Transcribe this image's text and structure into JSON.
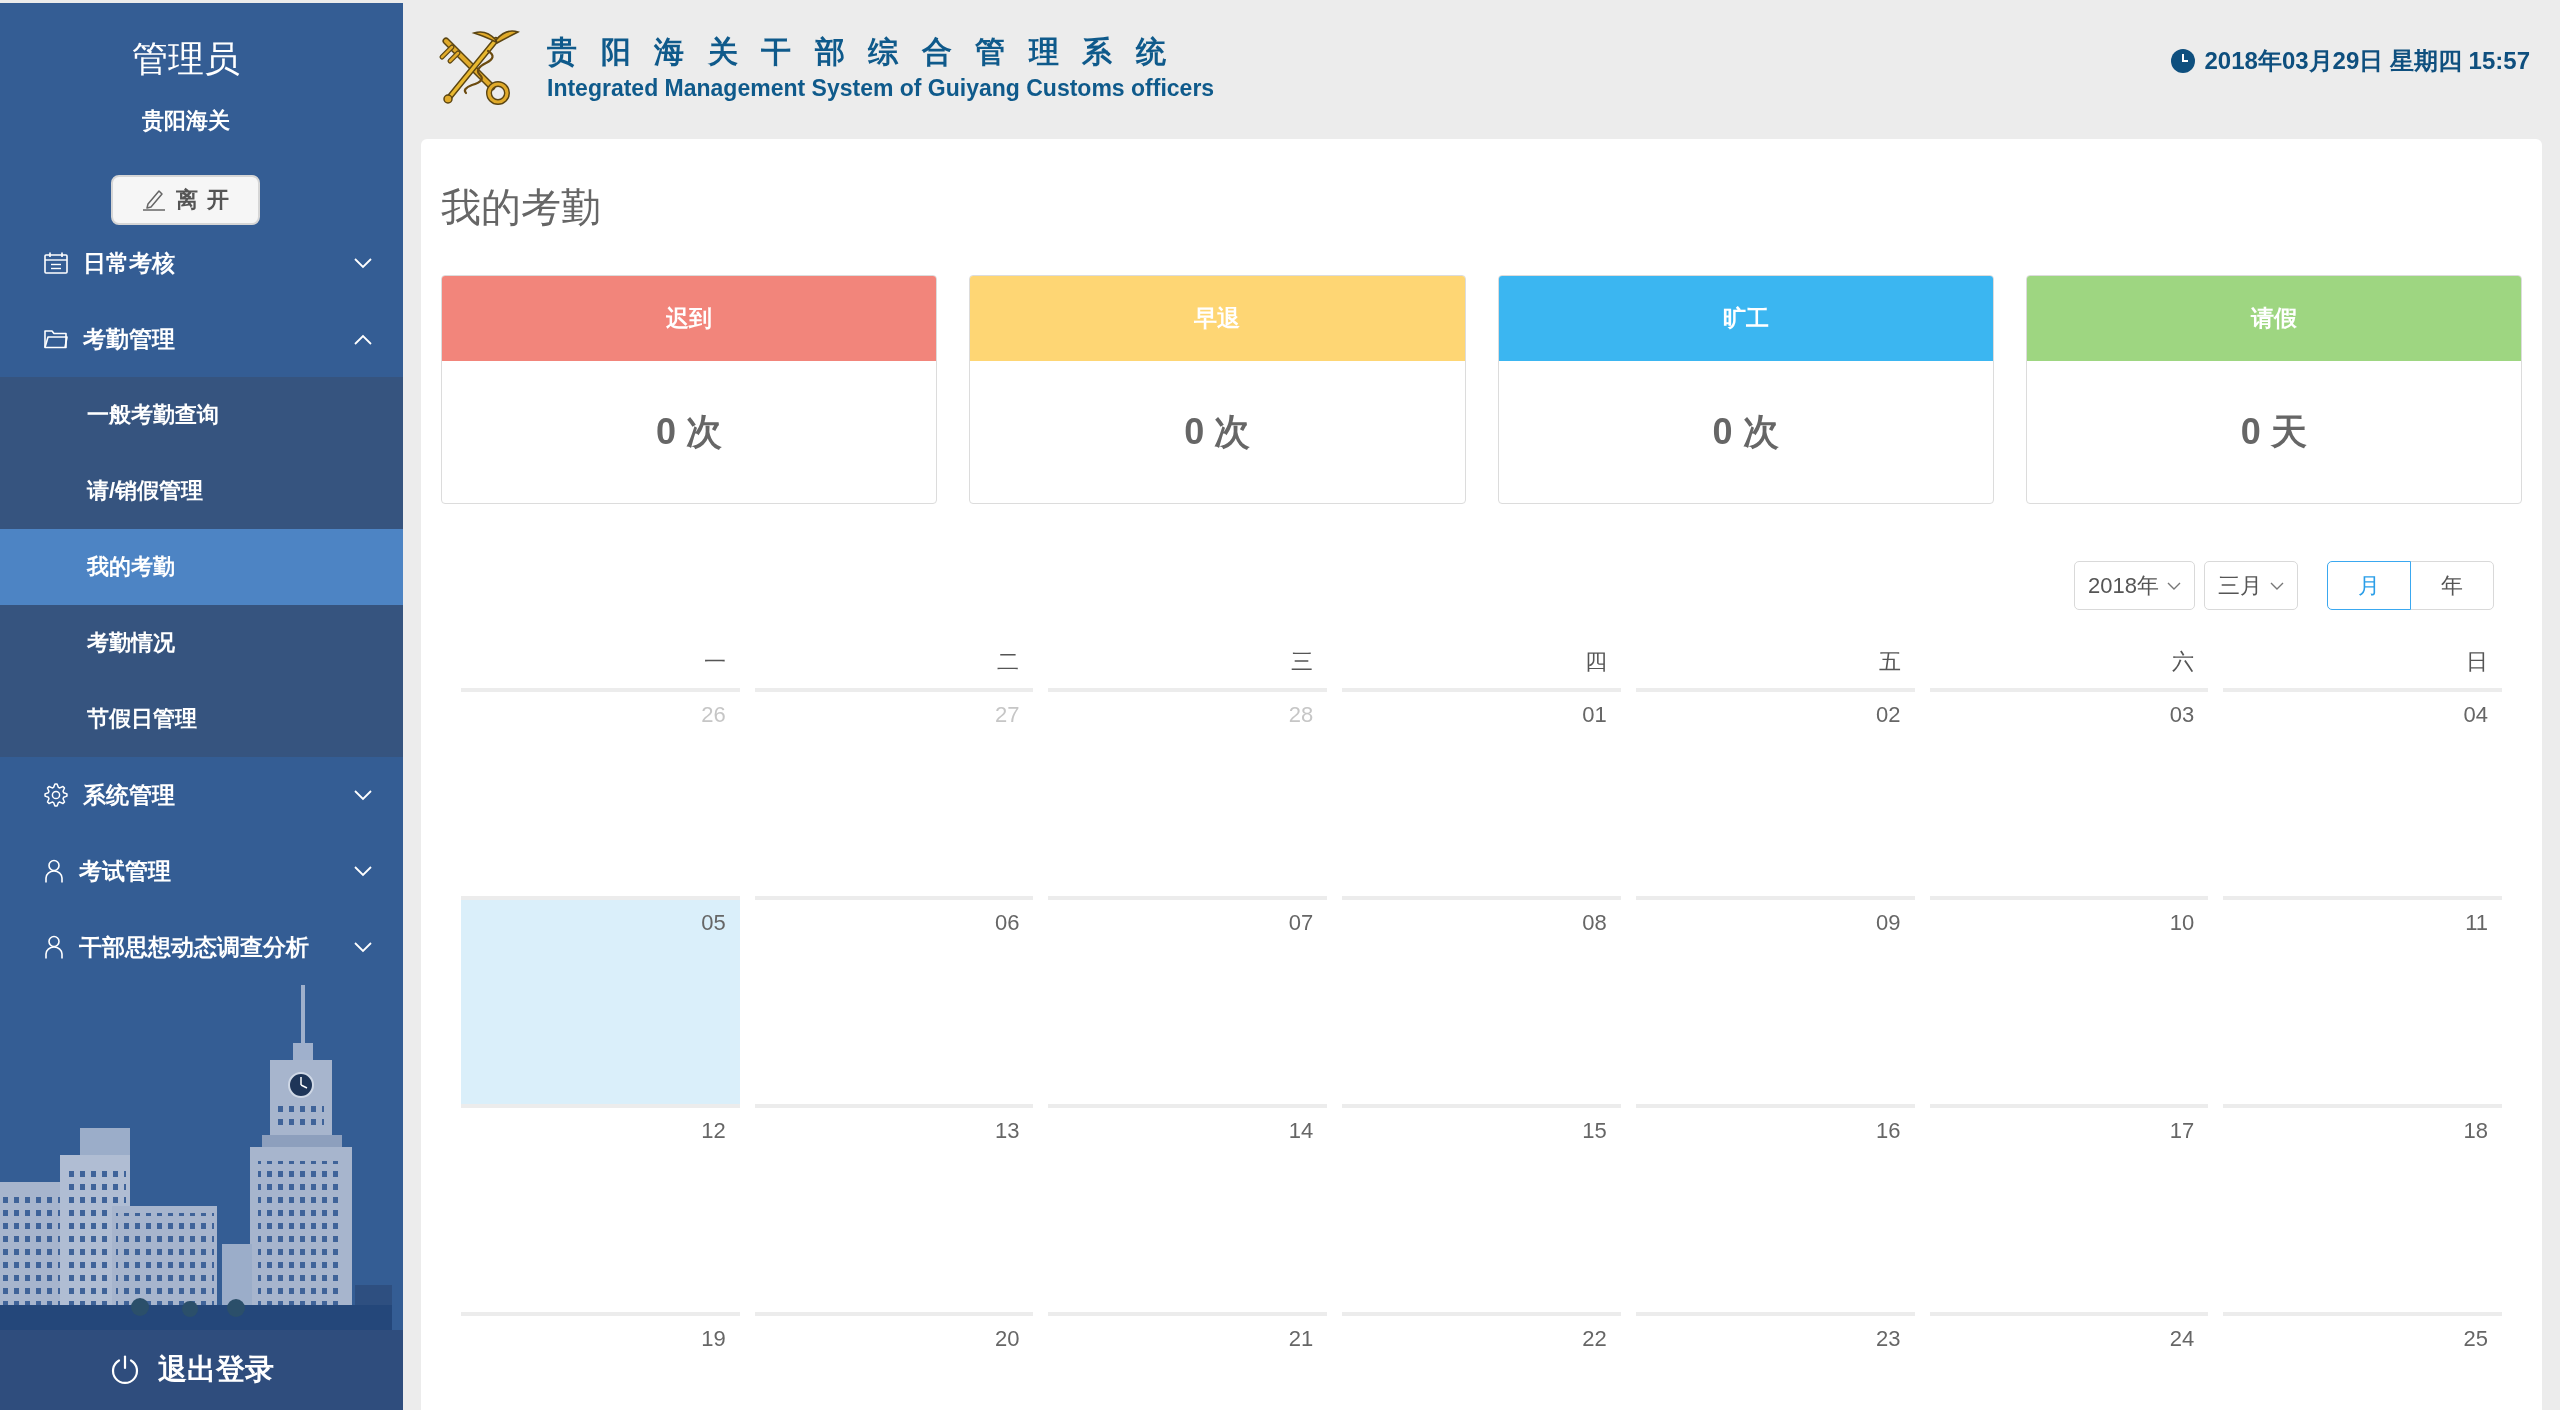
{
  "sidebar": {
    "user_name": "管理员",
    "organization": "贵阳海关",
    "leave_button": "离开",
    "menu": [
      {
        "kind": "calendar",
        "label": "日常考核",
        "expanded": false
      },
      {
        "kind": "folder",
        "label": "考勤管理",
        "expanded": true,
        "children": [
          {
            "label": "一般考勤查询",
            "selected": false
          },
          {
            "label": "请/销假管理",
            "selected": false
          },
          {
            "label": "我的考勤",
            "selected": true
          },
          {
            "label": "考勤情况",
            "selected": false
          },
          {
            "label": "节假日管理",
            "selected": false
          }
        ]
      },
      {
        "kind": "gear",
        "label": "系统管理",
        "expanded": false
      },
      {
        "kind": "person",
        "label": "考试管理",
        "expanded": false
      },
      {
        "kind": "person",
        "label": "干部思想动态调查分析",
        "expanded": false
      }
    ],
    "logout_button": "退出登录"
  },
  "header": {
    "title": "贵阳海关干部综合管理系统",
    "subtitle": "Integrated Management System of Guiyang Customs officers",
    "datetime": "2018年03月29日 星期四 15:57"
  },
  "page": {
    "title": "我的考勤",
    "stats": [
      {
        "label": "迟到",
        "value": "0 次",
        "color": "#f2857b"
      },
      {
        "label": "早退",
        "value": "0 次",
        "color": "#fed674"
      },
      {
        "label": "旷工",
        "value": "0 次",
        "color": "#3bb6f1"
      },
      {
        "label": "请假",
        "value": "0 天",
        "color": "#9ed681"
      }
    ],
    "calendar": {
      "year": "2018年",
      "month": "三月",
      "modes": [
        {
          "label": "月",
          "selected": true
        },
        {
          "label": "年",
          "selected": false
        }
      ],
      "weekdays": [
        "一",
        "二",
        "三",
        "四",
        "五",
        "六",
        "日"
      ],
      "weeks": [
        [
          {
            "day": "26",
            "muted": true,
            "selected": false
          },
          {
            "day": "27",
            "muted": true,
            "selected": false
          },
          {
            "day": "28",
            "muted": true,
            "selected": false
          },
          {
            "day": "01",
            "muted": false,
            "selected": false
          },
          {
            "day": "02",
            "muted": false,
            "selected": false
          },
          {
            "day": "03",
            "muted": false,
            "selected": false
          },
          {
            "day": "04",
            "muted": false,
            "selected": false
          }
        ],
        [
          {
            "day": "05",
            "muted": false,
            "selected": true
          },
          {
            "day": "06",
            "muted": false,
            "selected": false
          },
          {
            "day": "07",
            "muted": false,
            "selected": false
          },
          {
            "day": "08",
            "muted": false,
            "selected": false
          },
          {
            "day": "09",
            "muted": false,
            "selected": false
          },
          {
            "day": "10",
            "muted": false,
            "selected": false
          },
          {
            "day": "11",
            "muted": false,
            "selected": false
          }
        ],
        [
          {
            "day": "12",
            "muted": false,
            "selected": false
          },
          {
            "day": "13",
            "muted": false,
            "selected": false
          },
          {
            "day": "14",
            "muted": false,
            "selected": false
          },
          {
            "day": "15",
            "muted": false,
            "selected": false
          },
          {
            "day": "16",
            "muted": false,
            "selected": false
          },
          {
            "day": "17",
            "muted": false,
            "selected": false
          },
          {
            "day": "18",
            "muted": false,
            "selected": false
          }
        ],
        [
          {
            "day": "19",
            "muted": false,
            "selected": false
          },
          {
            "day": "20",
            "muted": false,
            "selected": false
          },
          {
            "day": "21",
            "muted": false,
            "selected": false
          },
          {
            "day": "22",
            "muted": false,
            "selected": false
          },
          {
            "day": "23",
            "muted": false,
            "selected": false
          },
          {
            "day": "24",
            "muted": false,
            "selected": false
          },
          {
            "day": "25",
            "muted": false,
            "selected": false
          }
        ]
      ]
    }
  }
}
